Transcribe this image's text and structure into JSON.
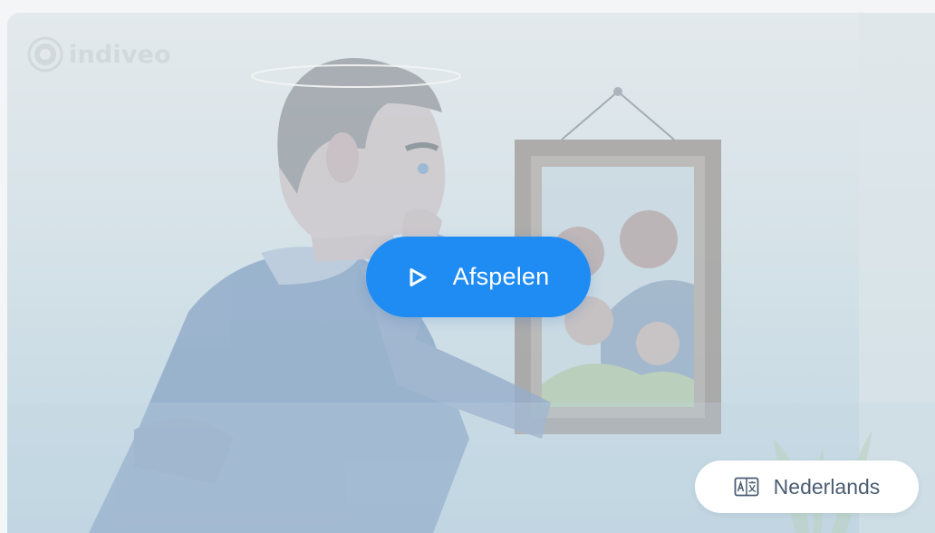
{
  "brand": {
    "name": "indiveo",
    "logo_icon": "indiveo-logo-icon"
  },
  "video": {
    "illustration": "man-looking-at-framed-family-photo"
  },
  "player": {
    "play_label": "Afspelen",
    "play_icon": "play-icon",
    "accent_color": "#1f8cf3"
  },
  "language": {
    "current": "Nederlands",
    "icon": "translate-icon"
  }
}
